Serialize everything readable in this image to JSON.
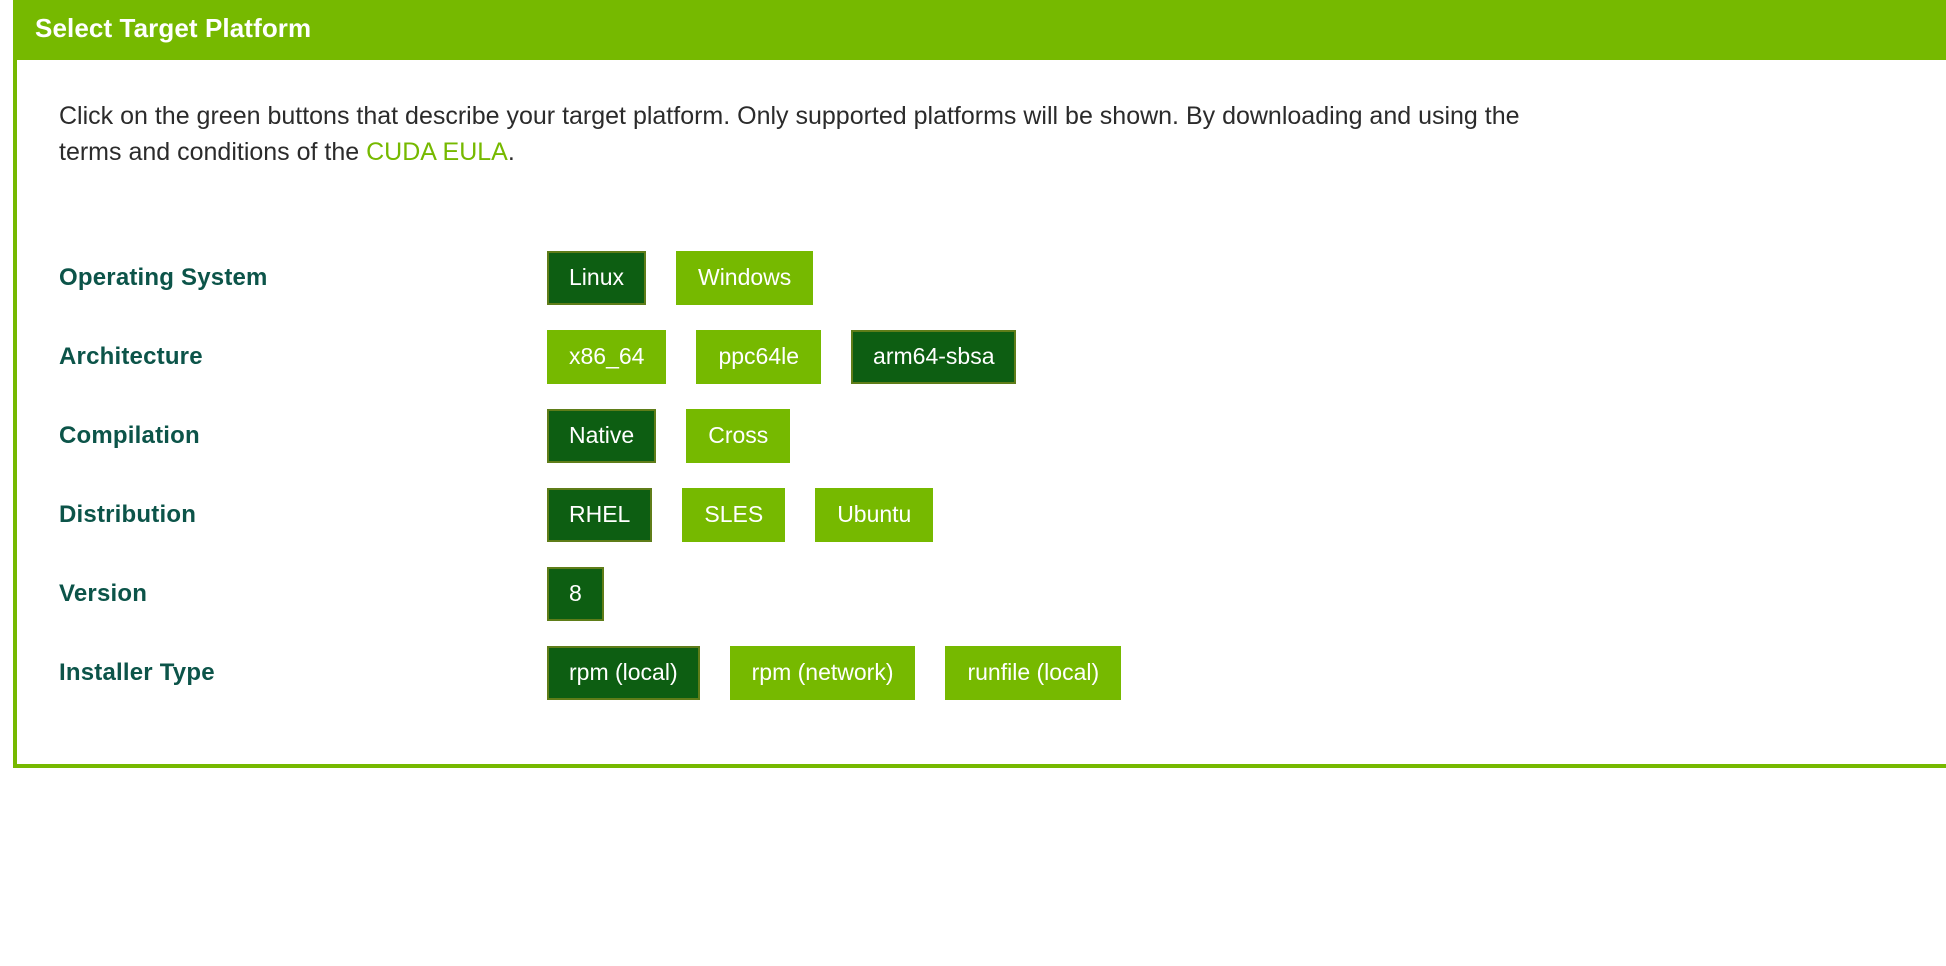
{
  "card": {
    "header_title": "Select Target Platform",
    "intro_before_link": "Click on the green buttons that describe your target platform. Only supported platforms will be shown. By downloading and using the\nterms and conditions of the ",
    "intro_link": "CUDA EULA",
    "intro_after_link": "."
  },
  "colors": {
    "brand_green": "#76b900",
    "selected_green": "#0d5e12",
    "selected_border": "#5f7d19",
    "label_teal": "#0c5449",
    "body_text": "#2b2b2b",
    "header_text": "#ffffff"
  },
  "rows": [
    {
      "label": "Operating System",
      "options": [
        {
          "label": "Linux",
          "selected": true
        },
        {
          "label": "Windows",
          "selected": false
        }
      ]
    },
    {
      "label": "Architecture",
      "options": [
        {
          "label": "x86_64",
          "selected": false
        },
        {
          "label": "ppc64le",
          "selected": false
        },
        {
          "label": "arm64-sbsa",
          "selected": true
        }
      ]
    },
    {
      "label": "Compilation",
      "options": [
        {
          "label": "Native",
          "selected": true
        },
        {
          "label": "Cross",
          "selected": false
        }
      ]
    },
    {
      "label": "Distribution",
      "options": [
        {
          "label": "RHEL",
          "selected": true
        },
        {
          "label": "SLES",
          "selected": false
        },
        {
          "label": "Ubuntu",
          "selected": false
        }
      ]
    },
    {
      "label": "Version",
      "options": [
        {
          "label": "8",
          "selected": true
        }
      ]
    },
    {
      "label": "Installer Type",
      "options": [
        {
          "label": "rpm (local)",
          "selected": true
        },
        {
          "label": "rpm (network)",
          "selected": false
        },
        {
          "label": "runfile (local)",
          "selected": false
        }
      ]
    }
  ]
}
